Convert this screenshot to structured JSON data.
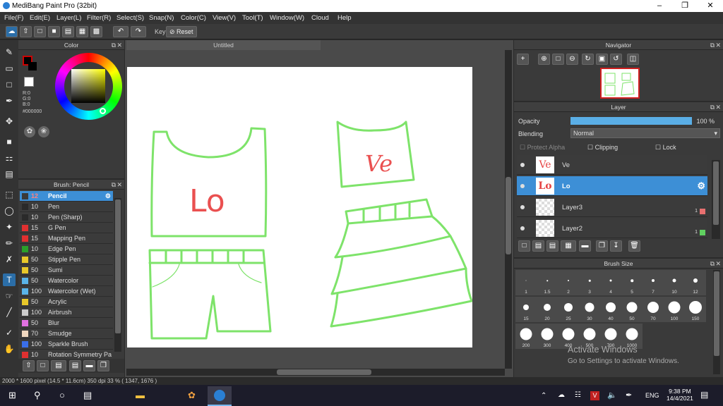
{
  "window": {
    "title": "MediBang Paint Pro (32bit)"
  },
  "menu": [
    "File(F)",
    "Edit(E)",
    "Layer(L)",
    "Filter(R)",
    "Select(S)",
    "Snap(N)",
    "Color(C)",
    "View(V)",
    "Tool(T)",
    "Window(W)",
    "Cloud",
    "Help"
  ],
  "toolbar": {
    "key_label": "Key",
    "reset_label": "Reset"
  },
  "color_panel": {
    "title": "Color",
    "r": "R:0",
    "g": "G:0",
    "b": "B:0",
    "hex": "#000000",
    "fg": "#000000",
    "bg": "#ffffff"
  },
  "brush_panel": {
    "title": "Brush: Pencil",
    "items": [
      {
        "size": "12",
        "name": "Pencil",
        "color": "#3a3a3a",
        "selected": true
      },
      {
        "size": "10",
        "name": "Pen",
        "color": "#2a2a2a"
      },
      {
        "size": "10",
        "name": "Pen (Sharp)",
        "color": "#2a2a2a"
      },
      {
        "size": "15",
        "name": "G Pen",
        "color": "#e03030"
      },
      {
        "size": "15",
        "name": "Mapping Pen",
        "color": "#e03030"
      },
      {
        "size": "10",
        "name": "Edge Pen",
        "color": "#2aa02a"
      },
      {
        "size": "50",
        "name": "Stipple Pen",
        "color": "#e8c82a"
      },
      {
        "size": "50",
        "name": "Sumi",
        "color": "#e8c82a"
      },
      {
        "size": "50",
        "name": "Watercolor",
        "color": "#5ab4e8"
      },
      {
        "size": "100",
        "name": "Watercolor (Wet)",
        "color": "#5ab4e8"
      },
      {
        "size": "50",
        "name": "Acrylic",
        "color": "#e8c82a"
      },
      {
        "size": "100",
        "name": "Airbrush",
        "color": "#cccccc"
      },
      {
        "size": "50",
        "name": "Blur",
        "color": "#e070e0"
      },
      {
        "size": "70",
        "name": "Smudge",
        "color": "#f0d8c0"
      },
      {
        "size": "100",
        "name": "Sparkle Brush",
        "color": "#3a6ee8"
      },
      {
        "size": "10",
        "name": "Rotation Symmetry Pa",
        "color": "#e03030"
      }
    ]
  },
  "canvas": {
    "tab": "Untitled",
    "text_left": "Lo",
    "text_right": "Ve",
    "stroke_color": "#7ee36a",
    "text_color": "#ea5050"
  },
  "navigator": {
    "title": "Navigator"
  },
  "layer_panel": {
    "title": "Layer",
    "opacity_label": "Opacity",
    "opacity_value": "100 %",
    "opacity_fraction": 1.0,
    "blending_label": "Blending",
    "blending_value": "Normal",
    "protect_alpha": "Protect Alpha",
    "clipping": "Clipping",
    "lock": "Lock",
    "layers": [
      {
        "name": "Ve",
        "thumb": "Ve"
      },
      {
        "name": "Lo",
        "thumb": "Lo",
        "selected": true
      },
      {
        "name": "Layer3",
        "thumb": "",
        "num": "1",
        "tag": "#e87070"
      },
      {
        "name": "Layer2",
        "thumb": "",
        "num": "1",
        "tag": "#60d060"
      }
    ]
  },
  "brush_size": {
    "title": "Brush Size",
    "sizes": [
      "1",
      "1.5",
      "2",
      "3",
      "4",
      "5",
      "7",
      "10",
      "12",
      "15",
      "20",
      "25",
      "30",
      "40",
      "50",
      "70",
      "100",
      "150",
      "200",
      "300",
      "400",
      "500",
      "700",
      "1000"
    ]
  },
  "statusbar": {
    "text": "2000 * 1600 pixel  (14.5 * 11.6cm)  350 dpi  33 %  ( 1347, 1676 )"
  },
  "watermark": {
    "line1": "Activate Windows",
    "line2": "Go to Settings to activate Windows."
  },
  "taskbar": {
    "lang": "ENG",
    "time": "9:38 PM",
    "date": "14/4/2021"
  }
}
